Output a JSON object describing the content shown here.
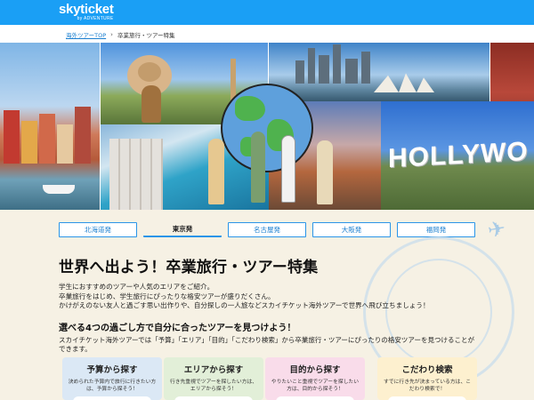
{
  "header": {
    "logo_main": "skyticket",
    "logo_sub": "by ADVENTURE"
  },
  "breadcrumb": {
    "home": "海外ツアーTOP",
    "separator": "›",
    "current": "卒業旅行・ツアー特集"
  },
  "hero": {
    "sign_text": "HOLLYWO"
  },
  "tabs": [
    {
      "label": "北海道発",
      "active": false
    },
    {
      "label": "東京発",
      "active": true
    },
    {
      "label": "名古屋発",
      "active": false
    },
    {
      "label": "大阪発",
      "active": false
    },
    {
      "label": "福岡発",
      "active": false
    }
  ],
  "main": {
    "title": "世界へ出よう！卒業旅行・ツアー特集",
    "intro_lines": [
      "学生におすすめのツアーや人気のエリアをご紹介。",
      "卒業旅行をはじめ、学生旅行にぴったりな格安ツアーが盛りだくさん。",
      "かけがえのない友人と過ごす思い出作りや、自分探しの一人旅などスカイチケット海外ツアーで世界へ飛び立ちましょう！"
    ],
    "subtitle": "選べる4つの過ごし方で自分に合ったツアーを見つけよう！",
    "description": "スカイチケット海外ツアーでは「予算」「エリア」「目的」「こだわり検索」から卒業旅行・ツアーにぴったりの格安ツアーを見つけることができます。"
  },
  "cards": [
    {
      "title": "予算から探す",
      "desc": "決められた予算内で旅行に行きたい方は、予算から探そう！"
    },
    {
      "title": "エリアから探す",
      "desc": "行き先重視でツアーを探したい方は、エリアから探そう！"
    },
    {
      "title": "目的から探す",
      "desc": "やりたいこと重視でツアーを探したい方は、目的から探そう！"
    },
    {
      "title": "こだわり検索",
      "desc": "すでに行き先が決まっている方は、こだわり検索で！"
    }
  ],
  "colors": {
    "header_blue": "#1a9ff5",
    "link_blue": "#1a7fd0",
    "page_bg": "#f6f1e4"
  }
}
